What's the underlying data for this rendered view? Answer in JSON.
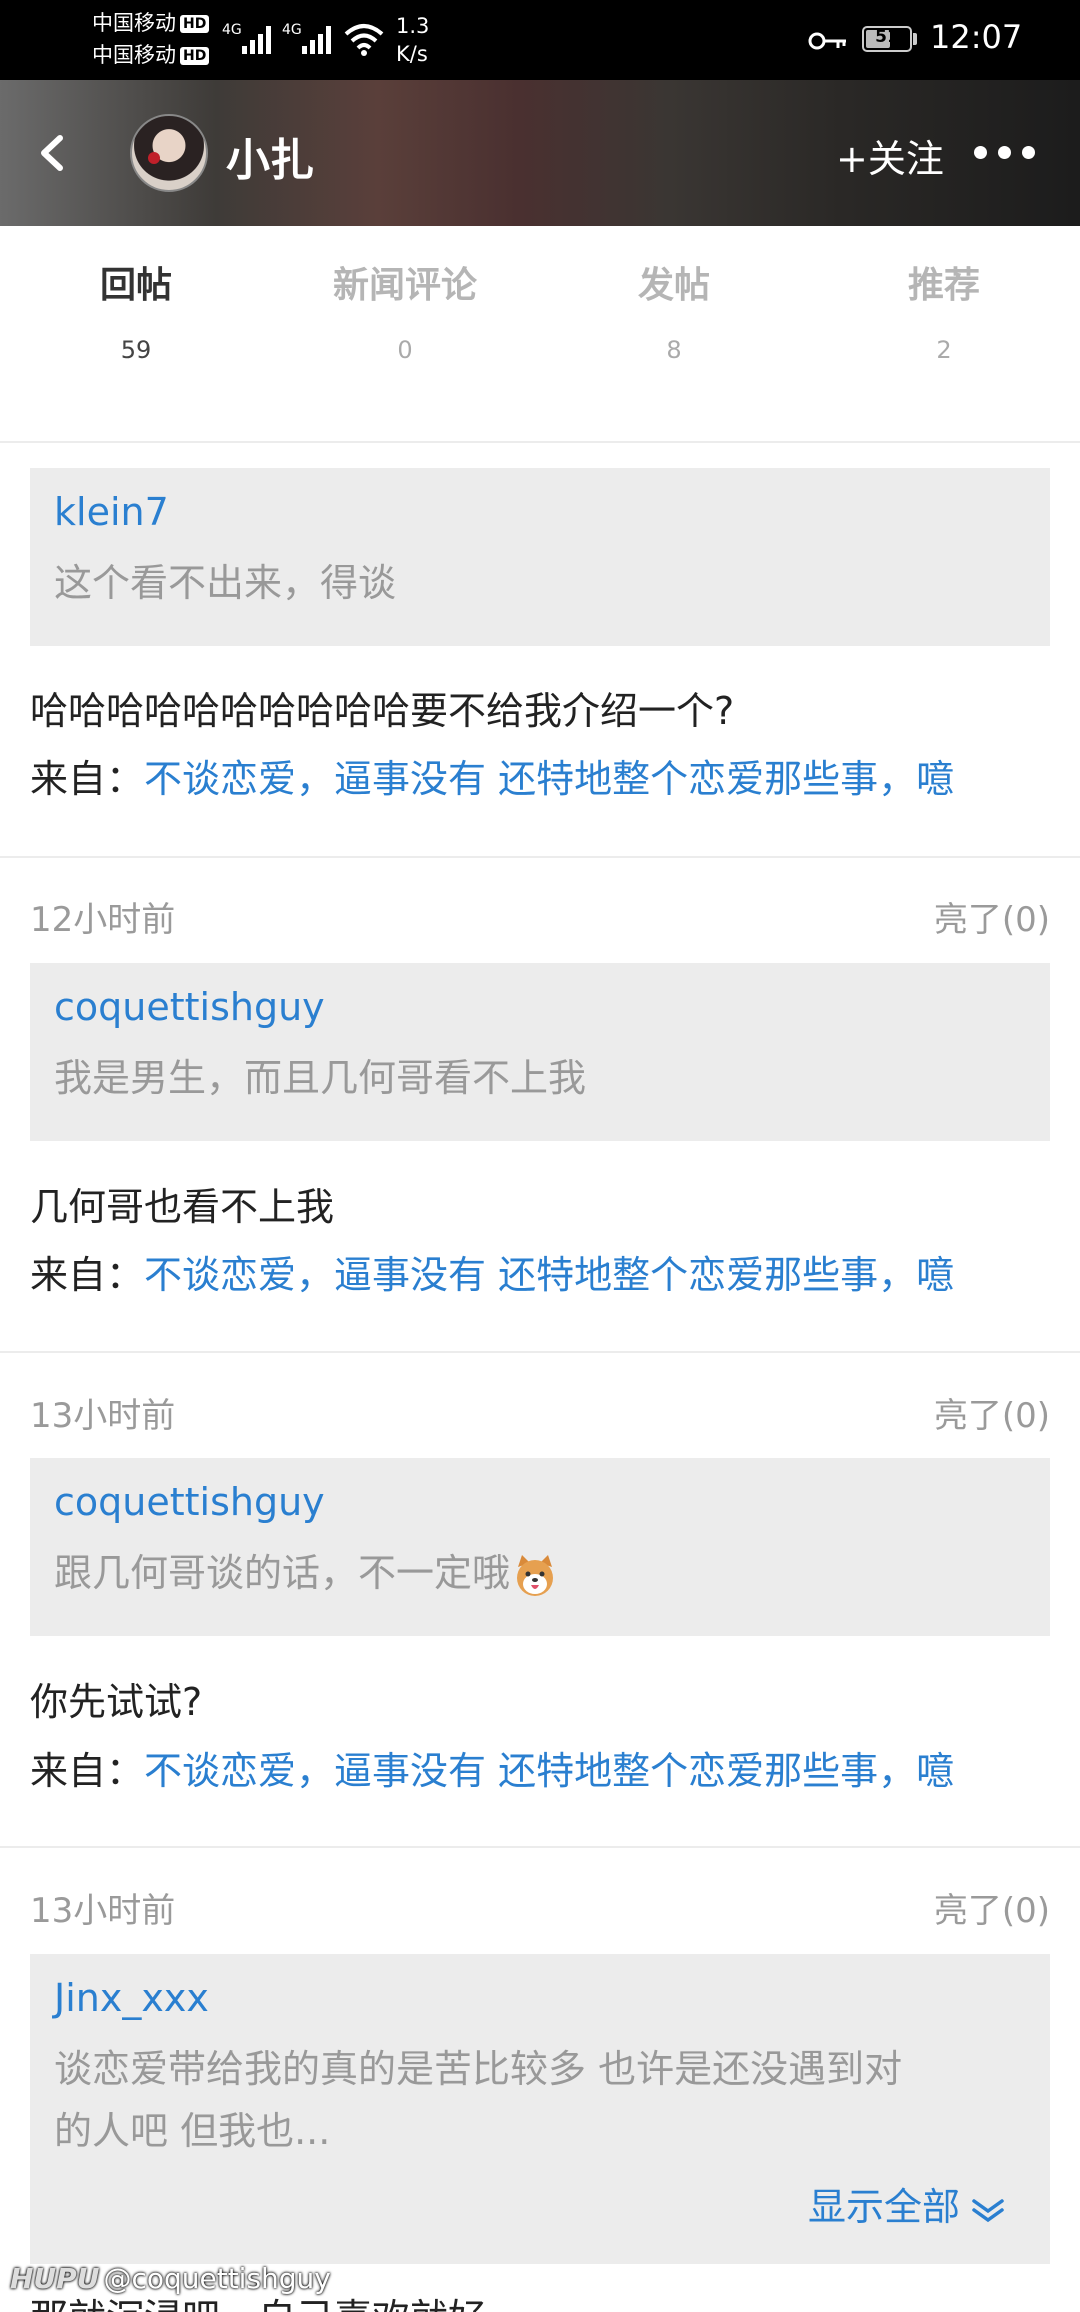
{
  "status_bar": {
    "carrier1": "中国移动",
    "carrier2": "中国移动",
    "hd": "HD",
    "net": "4G",
    "speed_value": "1.3",
    "speed_unit": "K/s",
    "battery": "51",
    "time": "12:07"
  },
  "header": {
    "back_icon": "chevron-left-icon",
    "user_name": "小扎",
    "follow_label": "+关注",
    "more_icon": "more-dots-icon"
  },
  "tabs": [
    {
      "label": "回帖",
      "count": "59",
      "active": true
    },
    {
      "label": "新闻评论",
      "count": "0",
      "active": false
    },
    {
      "label": "发帖",
      "count": "8",
      "active": false
    },
    {
      "label": "推荐",
      "count": "2",
      "active": false
    }
  ],
  "posts": [
    {
      "quote_user": "klein7",
      "quote_text": "这个看不出来，得谈",
      "reply": "哈哈哈哈哈哈哈哈哈哈要不给我介绍一个?",
      "from_prefix": "来自：",
      "from_link": "不谈恋爱，逼事没有 还特地整个恋爱那些事，噫"
    },
    {
      "time": "12小时前",
      "likes": "亮了(0)",
      "quote_user": "coquettishguy",
      "quote_text": "我是男生，而且几何哥看不上我",
      "reply": "几何哥也看不上我",
      "from_prefix": "来自：",
      "from_link": "不谈恋爱，逼事没有 还特地整个恋爱那些事，噫"
    },
    {
      "time": "13小时前",
      "likes": "亮了(0)",
      "quote_user": "coquettishguy",
      "quote_text": "跟几何哥谈的话，不一定哦",
      "reply": "你先试试?",
      "from_prefix": "来自：",
      "from_link": "不谈恋爱，逼事没有 还特地整个恋爱那些事，噫"
    },
    {
      "time": "13小时前",
      "likes": "亮了(0)",
      "quote_user": "Jinx_xxx",
      "quote_text_line1": "谈恋爱带给我的真的是苦比较多 也许是还没遇到对",
      "quote_text_line2": "的人吧 但我也...",
      "show_all": "显示全部",
      "reply_partial": "那就沉浸吧，自己喜欢就好"
    }
  ],
  "watermark": {
    "brand": "HUPU",
    "handle": "@coquettishguy"
  },
  "colors": {
    "link": "#2a7fd0",
    "quote_bg": "#ececec",
    "muted": "#9a9a9a"
  }
}
